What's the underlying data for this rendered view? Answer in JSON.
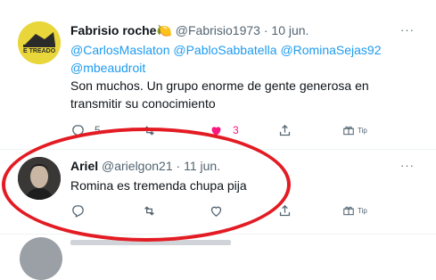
{
  "tweets": [
    {
      "name": "Fabrisio roche",
      "emoji": "🍋",
      "handle": "@Fabrisio1973",
      "dot": "·",
      "date": "10 jun.",
      "more": "···",
      "avatar_text": "E TREADO",
      "mentions_line1": [
        "@CarlosMaslaton",
        "@PabloSabbatella",
        "@RominaSejas92"
      ],
      "mentions_line2": "@mbeaudroit",
      "text_line1": "Son muchos. Un grupo enorme de gente generosa en",
      "text_line2": "transmitir su conocimiento",
      "reply_count": "5",
      "like_count": "3",
      "tip_label": "Tip"
    },
    {
      "name": "Ariel",
      "handle": "@arielgon21",
      "dot": "·",
      "date": "11 jun.",
      "more": "···",
      "text": "Romina es tremenda chupa pija",
      "tip_label": "Tip"
    }
  ],
  "colors": {
    "accent": "#1d9bf0",
    "like": "#f91880",
    "annotation": "#e31b23",
    "muted": "#536471"
  },
  "icons": [
    "reply-icon",
    "retweet-icon",
    "like-icon",
    "share-icon",
    "tip-icon",
    "more-icon"
  ]
}
